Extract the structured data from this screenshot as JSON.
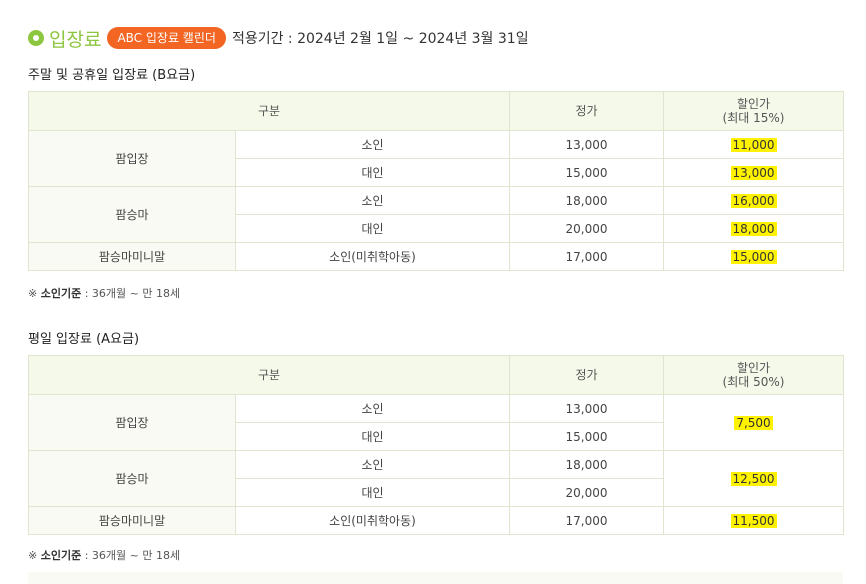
{
  "header": {
    "title": "입장료",
    "calendar_button": "ABC 입장료 캘린더",
    "period": "적용기간 : 2024년 2월 1일 ~ 2024년 3월 31일"
  },
  "sections": [
    {
      "title": "주말 및 공휴일 입장료 (B요금)",
      "col_category": "구분",
      "col_price": "정가",
      "col_discount_line1": "할인가",
      "col_discount_line2": "(최대 15%)",
      "groups": [
        {
          "name": "팜입장",
          "rows": [
            {
              "type": "소인",
              "price": "13,000",
              "discount": "11,000"
            },
            {
              "type": "대인",
              "price": "15,000",
              "discount": "13,000"
            }
          ]
        },
        {
          "name": "팜승마",
          "rows": [
            {
              "type": "소인",
              "price": "18,000",
              "discount": "16,000"
            },
            {
              "type": "대인",
              "price": "20,000",
              "discount": "18,000"
            }
          ]
        },
        {
          "name": "팜승마미니말",
          "rows": [
            {
              "type": "소인(미취학아동)",
              "price": "17,000",
              "discount": "15,000"
            }
          ]
        }
      ],
      "note_prefix": "※",
      "note_label": "소인기준",
      "note_text": ": 36개월 ~ 만 18세"
    },
    {
      "title": "평일 입장료 (A요금)",
      "col_category": "구분",
      "col_price": "정가",
      "col_discount_line1": "할인가",
      "col_discount_line2": "(최대 50%)",
      "groups": [
        {
          "name": "팜입장",
          "discount": "7,500",
          "rows": [
            {
              "type": "소인",
              "price": "13,000"
            },
            {
              "type": "대인",
              "price": "15,000"
            }
          ]
        },
        {
          "name": "팜승마",
          "discount": "12,500",
          "rows": [
            {
              "type": "소인",
              "price": "18,000"
            },
            {
              "type": "대인",
              "price": "20,000"
            }
          ]
        },
        {
          "name": "팜승마미니말",
          "discount": "11,500",
          "rows": [
            {
              "type": "소인(미취학아동)",
              "price": "17,000"
            }
          ]
        }
      ],
      "note_prefix": "※",
      "note_label": "소인기준",
      "note_text": ": 36개월 ~ 만 18세"
    }
  ],
  "colors": {
    "accent_green": "#8dc63f",
    "button_orange": "#f26522",
    "highlight_yellow": "#fff200",
    "header_bg": "#f5f9ea"
  }
}
